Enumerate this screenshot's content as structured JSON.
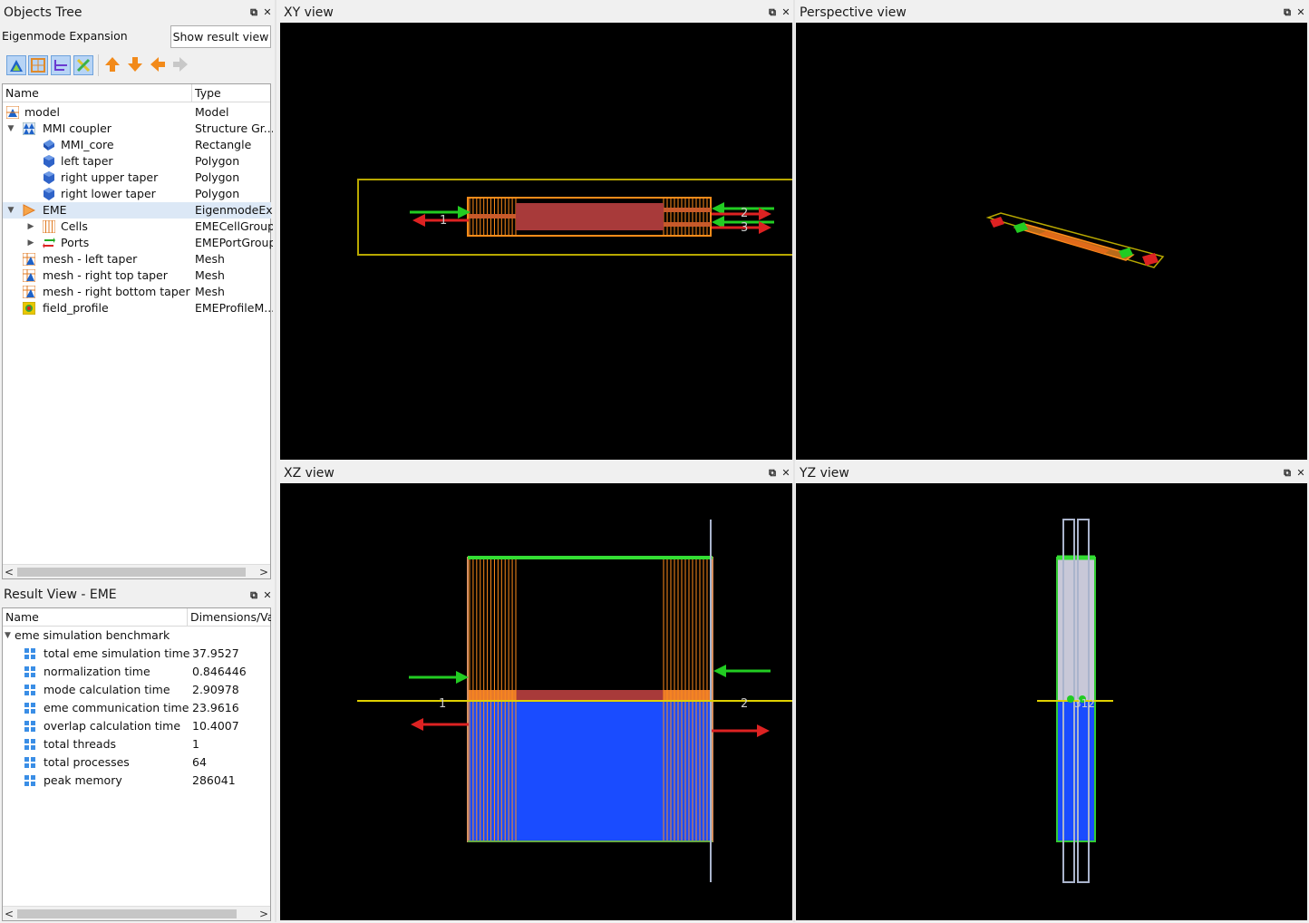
{
  "objects_tree": {
    "title": "Objects Tree",
    "layout_label": "Eigenmode Expansion Layout",
    "show_result_button": "Show result view",
    "columns": [
      "Name",
      "Type"
    ],
    "items": [
      {
        "name": "model",
        "type": "Model",
        "icon": "model-icon"
      },
      {
        "name": "MMI coupler",
        "type": "Structure Gr...",
        "icon": "structure-group-icon"
      },
      {
        "name": "MMI_core",
        "type": "Rectangle",
        "icon": "rectangle-icon"
      },
      {
        "name": "left taper",
        "type": "Polygon",
        "icon": "polygon-icon"
      },
      {
        "name": "right upper taper",
        "type": "Polygon",
        "icon": "polygon-icon"
      },
      {
        "name": "right lower taper",
        "type": "Polygon",
        "icon": "polygon-icon"
      },
      {
        "name": "EME",
        "type": "EigenmodeEx...",
        "icon": "eme-solver-icon"
      },
      {
        "name": "Cells",
        "type": "EMECellGroup",
        "icon": "cells-icon"
      },
      {
        "name": "Ports",
        "type": "EMEPortGroup",
        "icon": "ports-icon"
      },
      {
        "name": "mesh - left taper",
        "type": "Mesh",
        "icon": "mesh-icon"
      },
      {
        "name": "mesh - right top taper",
        "type": "Mesh",
        "icon": "mesh-icon"
      },
      {
        "name": "mesh - right bottom taper",
        "type": "Mesh",
        "icon": "mesh-icon"
      },
      {
        "name": "field_profile",
        "type": "EMEProfileM...",
        "icon": "profile-monitor-icon"
      }
    ]
  },
  "result_view": {
    "title": "Result View - EME",
    "columns": [
      "Name",
      "Dimensions/Va"
    ],
    "group": "eme simulation benchmark",
    "rows": [
      {
        "name": "total eme simulation time",
        "value": "37.9527"
      },
      {
        "name": "normalization time",
        "value": "0.846446"
      },
      {
        "name": "mode calculation time",
        "value": "2.90978"
      },
      {
        "name": "eme communication time",
        "value": "23.9616"
      },
      {
        "name": "overlap calculation time",
        "value": "10.4007"
      },
      {
        "name": "total threads",
        "value": "1"
      },
      {
        "name": "total processes",
        "value": "64"
      },
      {
        "name": "peak memory",
        "value": "286041"
      }
    ]
  },
  "views": {
    "xy": {
      "title": "XY view",
      "port_labels": [
        "1",
        "2",
        "3"
      ]
    },
    "perspective": {
      "title": "Perspective view"
    },
    "xz": {
      "title": "XZ view",
      "port_labels": [
        "1",
        "2"
      ]
    },
    "yz": {
      "title": "YZ view",
      "port_label": "312"
    }
  },
  "colors": {
    "sim_region": "#b8a800",
    "structure": "#a83a3a",
    "mesh": "#ff8c1a",
    "port_in": "#22cc22",
    "port_out": "#dd2222",
    "substrate": "#1a4cff"
  }
}
